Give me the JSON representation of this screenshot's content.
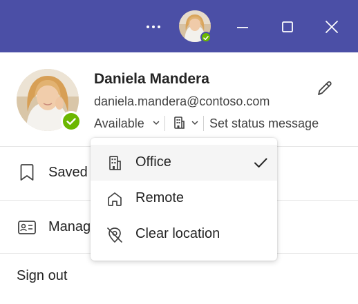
{
  "titlebar": {
    "color": "#4b4fa6",
    "more_icon": "more-horizontal-icon",
    "minimize_icon": "minimize-icon",
    "maximize_icon": "maximize-icon",
    "close_icon": "close-icon"
  },
  "profile": {
    "name": "Daniela Mandera",
    "email": "daniela.mandera@contoso.com",
    "presence_color": "#6bb700",
    "edit_icon": "pencil-icon"
  },
  "status": {
    "availability": "Available",
    "location_icon": "building-icon",
    "message": "Set status message"
  },
  "menu": {
    "items": [
      {
        "label": "Saved",
        "icon": "bookmark-icon"
      },
      {
        "label": "Manage",
        "icon": "contact-card-icon"
      }
    ],
    "sign_out": "Sign out"
  },
  "location_dropdown": {
    "items": [
      {
        "label": "Office",
        "icon": "building-icon",
        "selected": true
      },
      {
        "label": "Remote",
        "icon": "home-icon",
        "selected": false
      },
      {
        "label": "Clear location",
        "icon": "location-off-icon",
        "selected": false
      }
    ],
    "check_icon": "checkmark-icon"
  }
}
